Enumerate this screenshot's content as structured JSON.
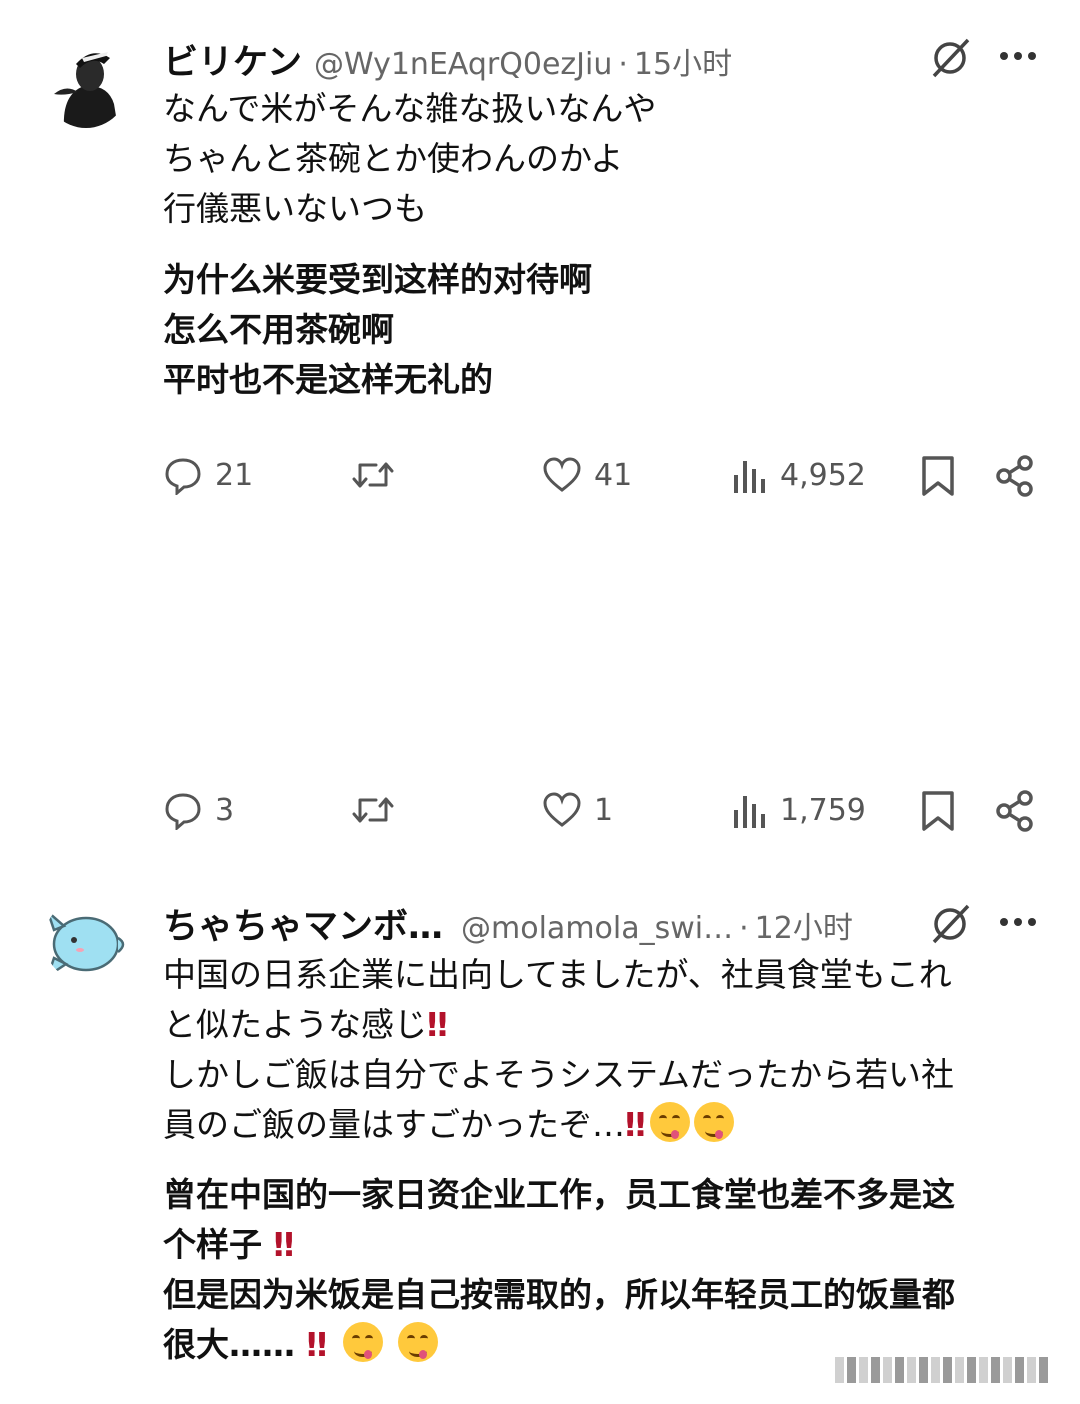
{
  "post1": {
    "display_name": "ビリケン",
    "handle": "@Wy1nEAqrQ0ezJiu",
    "separator": "·",
    "time": "15小时",
    "text_jp": [
      "なんで米がそんな雑な扱いなんや",
      "ちゃんと茶碗とか使わんのかよ",
      "行儀悪いないつも"
    ],
    "text_cn": [
      "为什么米要受到这样的对待啊",
      "怎么不用茶碗啊",
      "平时也不是这样无礼的"
    ],
    "actions": {
      "replies": "21",
      "likes": "41",
      "views": "4,952"
    }
  },
  "post_middle": {
    "actions": {
      "replies": "3",
      "likes": "1",
      "views": "1,759"
    }
  },
  "post2": {
    "display_name": "ちゃちゃマンボ…",
    "handle": "@molamola_swi…",
    "separator": "·",
    "time": "12小时",
    "text_jp": [
      "中国の日系企業に出向してましたが、社員食堂もこれ",
      "と似たような感じ",
      "しかしご飯は自分でよそうシステムだったから若い社",
      "員のご飯の量はすごかったぞ…"
    ],
    "text_cn": [
      "曾在中国的一家日资企业工作，员工食堂也差不多是这",
      "个样子",
      "但是因为米饭是自己按需取的，所以年轻员工的饭量都",
      "很大……"
    ],
    "bang": "‼"
  },
  "icons": [
    "grok-icon",
    "more-icon",
    "reply-icon",
    "retweet-icon",
    "like-icon",
    "views-icon",
    "bookmark-icon",
    "share-icon",
    "yum-emoji-icon"
  ],
  "colors": {
    "text": "#111111",
    "muted": "#666666",
    "icon": "#555555",
    "bang": "#b3122b",
    "emoji": "#ffc93c"
  }
}
